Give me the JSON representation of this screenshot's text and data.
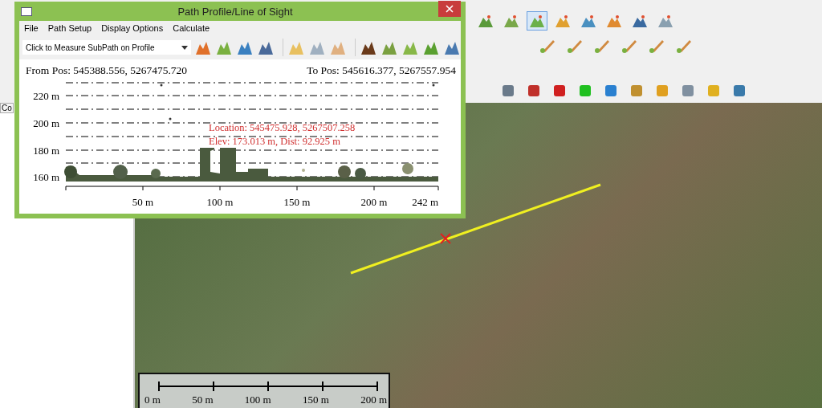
{
  "map_toolbar": [
    {
      "selected": false
    },
    {
      "selected": false
    },
    {
      "selected": true
    },
    {
      "selected": false
    },
    {
      "selected": false
    },
    {
      "selected": false
    },
    {
      "selected": false
    },
    {
      "selected": false
    }
  ],
  "left_panel": {
    "tab_label": "Co"
  },
  "dialog": {
    "title": "Path Profile/Line of Sight",
    "menu": [
      "File",
      "Path Setup",
      "Display Options",
      "Calculate"
    ],
    "mode_select": {
      "value": "Click to Measure SubPath on Profile"
    },
    "from_pos": "From Pos: 545388.556, 5267475.720",
    "to_pos": "To Pos: 545616.377, 5267557.954",
    "y_labels": [
      "220 m",
      "200 m",
      "180 m",
      "160 m"
    ],
    "x_labels": [
      "50 m",
      "100 m",
      "150 m",
      "200 m",
      "242 m"
    ],
    "location": "Location: 545475.928, 5267507.258",
    "elevation": "Elev: 173.013 m, Dist: 92.925 m"
  },
  "scale_bar": {
    "labels": [
      "0 m",
      "50 m",
      "100 m",
      "150 m",
      "200 m"
    ]
  }
}
